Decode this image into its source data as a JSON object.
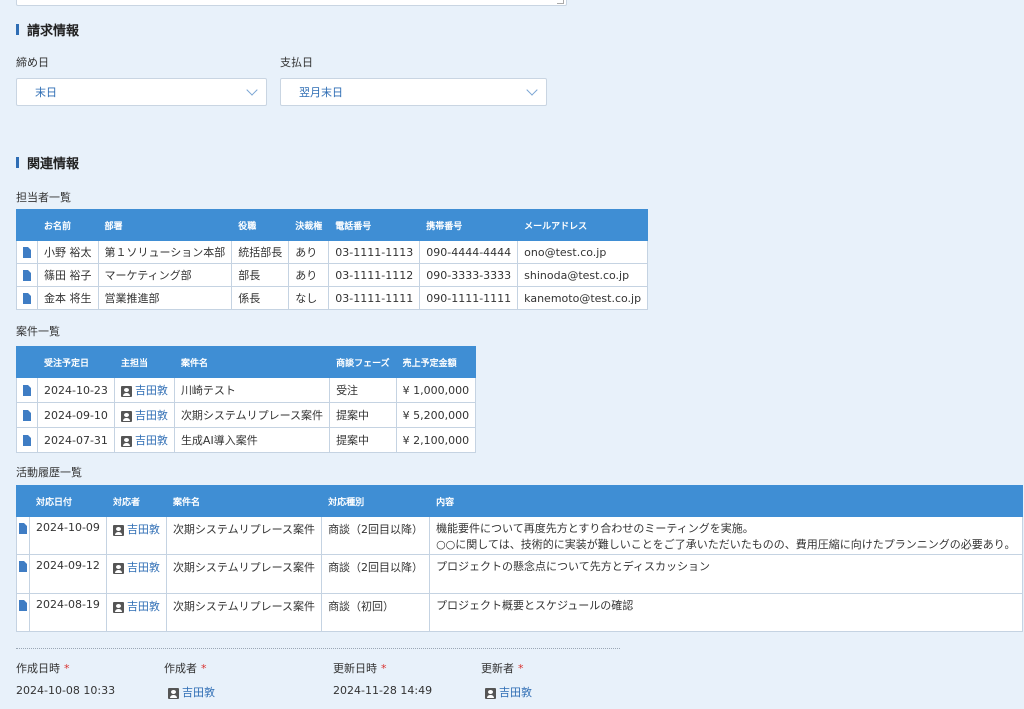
{
  "billing": {
    "title": "請求情報",
    "closing_label": "締め日",
    "closing_value": "末日",
    "payment_label": "支払日",
    "payment_value": "翌月末日"
  },
  "related": {
    "title": "関連情報",
    "contacts": {
      "title": "担当者一覧",
      "headers": [
        "お名前",
        "部署",
        "役職",
        "決裁権",
        "電話番号",
        "携帯番号",
        "メールアドレス"
      ],
      "rows": [
        {
          "name": "小野 裕太",
          "dept": "第１ソリューション本部",
          "position": "統括部長",
          "authority": "あり",
          "phone": "03-1111-1113",
          "mobile": "090-4444-4444",
          "email": "ono@test.co.jp"
        },
        {
          "name": "篠田 裕子",
          "dept": "マーケティング部",
          "position": "部長",
          "authority": "あり",
          "phone": "03-1111-1112",
          "mobile": "090-3333-3333",
          "email": "shinoda@test.co.jp"
        },
        {
          "name": "金本 将生",
          "dept": "営業推進部",
          "position": "係長",
          "authority": "なし",
          "phone": "03-1111-1111",
          "mobile": "090-1111-1111",
          "email": "kanemoto@test.co.jp"
        }
      ]
    },
    "deals": {
      "title": "案件一覧",
      "headers": [
        "受注予定日",
        "主担当",
        "案件名",
        "商談フェーズ",
        "売上予定金額"
      ],
      "rows": [
        {
          "date": "2024-10-23",
          "owner": "吉田敦",
          "name": "川崎テスト",
          "phase": "受注",
          "amount": "¥ 1,000,000"
        },
        {
          "date": "2024-09-10",
          "owner": "吉田敦",
          "name": "次期システムリプレース案件",
          "phase": "提案中",
          "amount": "¥ 5,200,000"
        },
        {
          "date": "2024-07-31",
          "owner": "吉田敦",
          "name": "生成AI導入案件",
          "phase": "提案中",
          "amount": "¥ 2,100,000"
        }
      ]
    },
    "activities": {
      "title": "活動履歴一覧",
      "headers": [
        "対応日付",
        "対応者",
        "案件名",
        "対応種別",
        "内容"
      ],
      "rows": [
        {
          "date": "2024-10-09",
          "person": "吉田敦",
          "deal": "次期システムリプレース案件",
          "type": "商談（2回目以降）",
          "content1": "機能要件について再度先方とすり合わせのミーティングを実施。",
          "content2": "○○に関しては、技術的に実装が難しいことをご了承いただいたものの、費用圧縮に向けたプランニングの必要あり。"
        },
        {
          "date": "2024-09-12",
          "person": "吉田敦",
          "deal": "次期システムリプレース案件",
          "type": "商談（2回目以降）",
          "content1": "プロジェクトの懸念点について先方とディスカッション",
          "content2": ""
        },
        {
          "date": "2024-08-19",
          "person": "吉田敦",
          "deal": "次期システムリプレース案件",
          "type": "商談（初回）",
          "content1": "プロジェクト概要とスケジュールの確認",
          "content2": ""
        }
      ]
    }
  },
  "meta": {
    "created_at_label": "作成日時",
    "created_at": "2024-10-08 10:33",
    "created_by_label": "作成者",
    "created_by": "吉田敦",
    "updated_at_label": "更新日時",
    "updated_at": "2024-11-28 14:49",
    "updated_by_label": "更新者",
    "updated_by": "吉田敦",
    "required_mark": "*"
  }
}
